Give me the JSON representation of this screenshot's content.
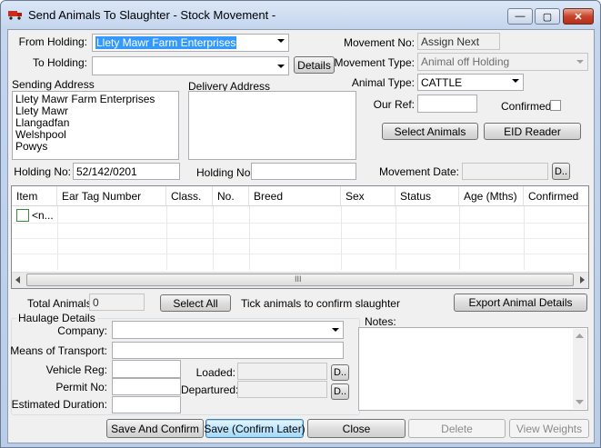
{
  "window": {
    "title": "Send Animals To Slaughter - Stock Movement -",
    "minimize": "—",
    "maximize": "▢",
    "close": "✕"
  },
  "from_holding": {
    "label": "From Holding:",
    "value": "Llety Mawr Farm Enterprises"
  },
  "to_holding": {
    "label": "To Holding:",
    "value": "",
    "details_button": "Details"
  },
  "sending_address": {
    "label": "Sending Address",
    "lines": [
      "Llety Mawr Farm Enterprises",
      "Llety Mawr",
      "Llangadfan",
      "Welshpool",
      "Powys"
    ]
  },
  "delivery_address": {
    "label": "Delivery Address",
    "lines": []
  },
  "holding_no_send": {
    "label": "Holding No:",
    "value": "52/142/0201"
  },
  "holding_no_delivery": {
    "label": "Holding No:",
    "value": ""
  },
  "movement_no": {
    "label": "Movement No:",
    "value": "Assign Next"
  },
  "movement_type": {
    "label": "Movement Type:",
    "value": "Animal off Holding"
  },
  "animal_type": {
    "label": "Animal Type:",
    "value": "CATTLE"
  },
  "our_ref": {
    "label": "Our Ref:",
    "value": ""
  },
  "confirmed": {
    "label": "Confirmed:",
    "checked": false
  },
  "buttons": {
    "select_animals": "Select Animals",
    "eid_reader": "EID Reader",
    "movement_date_picker": "D..",
    "select_all": "Select All",
    "export_animal_details": "Export Animal Details",
    "loaded_picker": "D..",
    "departured_picker": "D..",
    "save_and_confirm": "Save And Confirm",
    "save_confirm_later": "Save (Confirm Later)",
    "close": "Close",
    "delete": "Delete",
    "view_weights": "View Weights"
  },
  "movement_date": {
    "label": "Movement Date:",
    "value": ""
  },
  "grid": {
    "columns": [
      "Item",
      "Ear Tag Number",
      "Class.",
      "No.",
      "Breed",
      "Sex",
      "Status",
      "Age (Mths)",
      "Confirmed"
    ],
    "rows": [
      {
        "item": "<n..."
      }
    ],
    "scroll_thumb": "III"
  },
  "total_animals": {
    "label": "Total Animals:",
    "value": "0"
  },
  "tick_note": "Tick animals to confirm slaughter",
  "haulage": {
    "legend": "Haulage Details",
    "company_label": "Company:",
    "company_value": "",
    "means_label": "Means of Transport:",
    "means_value": "",
    "vehicle_label": "Vehicle Reg:",
    "vehicle_value": "",
    "permit_label": "Permit No:",
    "permit_value": "",
    "duration_label": "Estimated Duration:",
    "duration_value": "",
    "loaded_label": "Loaded:",
    "loaded_value": "",
    "departured_label": "Departured:",
    "departured_value": ""
  },
  "notes": {
    "label": "Notes:",
    "value": ""
  },
  "colors": {
    "title_bar": "#c4d6ee",
    "selection": "#3399ff",
    "close_button": "#c7432a",
    "form_background": "#f0f0f0"
  }
}
